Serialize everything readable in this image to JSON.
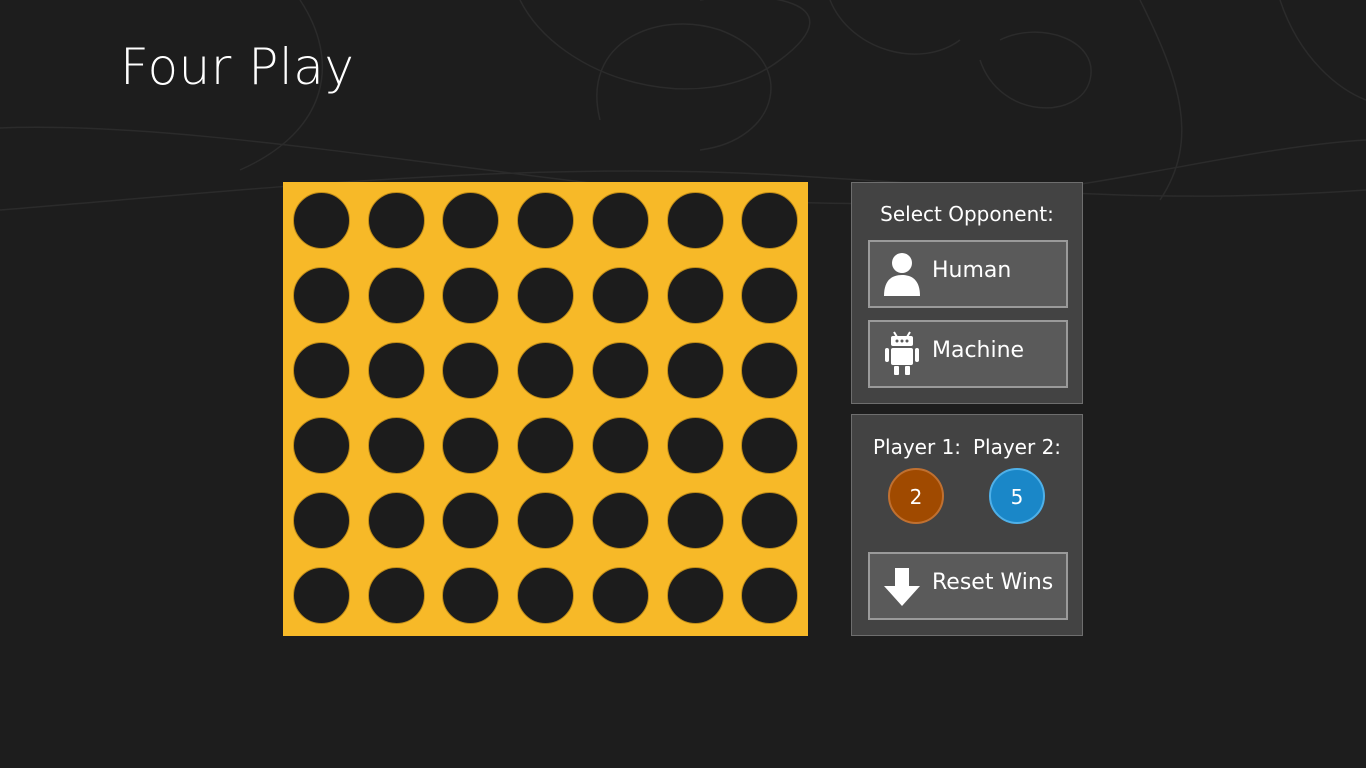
{
  "app": {
    "title": "Four Play"
  },
  "board": {
    "columns": 7,
    "rows": 6,
    "board_color": "#f7b928",
    "empty_slot_color": "#1c1c1c"
  },
  "opponent_panel": {
    "heading": "Select Opponent:",
    "human_button": {
      "label": "Human",
      "icon": "person-icon"
    },
    "machine_button": {
      "label": "Machine",
      "icon": "robot-icon"
    }
  },
  "score_panel": {
    "player1": {
      "label": "Player 1:",
      "wins": "2",
      "color": "#a04a00"
    },
    "player2": {
      "label": "Player 2:",
      "wins": "5",
      "color": "#1a87c8"
    },
    "reset_button": {
      "label": "Reset Wins",
      "icon": "down-arrow-icon"
    }
  },
  "theme": {
    "background": "#1d1d1d",
    "panel_background": "#434343",
    "button_background": "#5a5a5a"
  }
}
